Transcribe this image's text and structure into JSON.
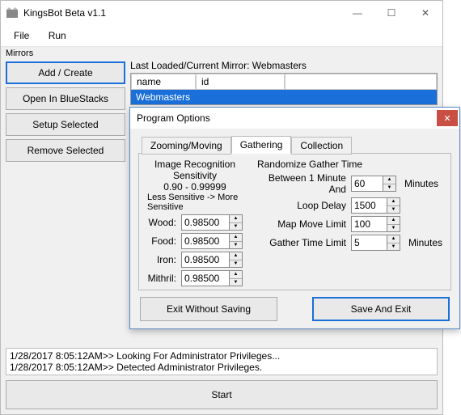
{
  "main": {
    "title": "KingsBot Beta v1.1",
    "menu": {
      "file": "File",
      "run": "Run"
    },
    "mirrors_label": "Mirrors",
    "side_buttons": {
      "add": "Add / Create",
      "open": "Open In BlueStacks",
      "setup": "Setup Selected",
      "remove": "Remove Selected"
    },
    "loaded_label": "Last Loaded/Current Mirror: Webmasters",
    "grid": {
      "head_name": "name",
      "head_id": "id",
      "row_name": "Webmasters",
      "row_id": ""
    },
    "log": {
      "line1": "1/28/2017 8:05:12AM>> Looking For Administrator Privileges...",
      "line2": "1/28/2017 8:05:12AM>> Detected Administrator Privileges."
    },
    "start": "Start"
  },
  "dialog": {
    "title": "Program Options",
    "tabs": {
      "zoom": "Zooming/Moving",
      "gather": "Gathering",
      "collect": "Collection"
    },
    "left": {
      "header1": "Image Recognition Sensitivity",
      "header2": "0.90 - 0.99999",
      "legend": "Less Sensitive -> More Sensitive",
      "wood_label": "Wood:",
      "wood": "0.98500",
      "food_label": "Food:",
      "food": "0.98500",
      "iron_label": "Iron:",
      "iron": "0.98500",
      "mithril_label": "Mithril:",
      "mithril": "0.98500"
    },
    "right": {
      "header": "Randomize Gather Time",
      "between_label": "Between 1 Minute And",
      "between": "60",
      "between_suffix": "Minutes",
      "loop_label": "Loop Delay",
      "loop": "1500",
      "map_label": "Map Move Limit",
      "map": "100",
      "gtl_label": "Gather Time Limit",
      "gtl": "5",
      "gtl_suffix": "Minutes"
    },
    "buttons": {
      "exit": "Exit Without Saving",
      "save": "Save And Exit"
    }
  }
}
